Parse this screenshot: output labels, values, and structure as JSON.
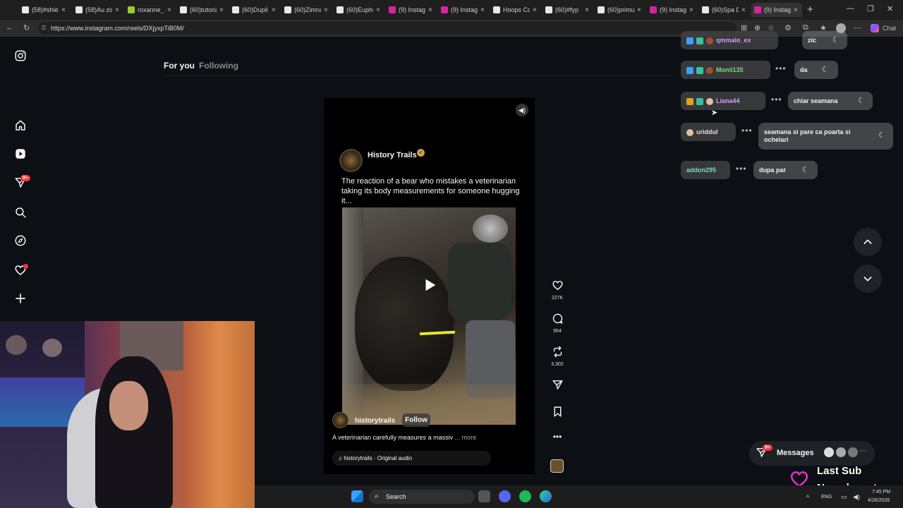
{
  "browser": {
    "tabs": [
      {
        "title": "(58)#shie",
        "icon": "tiktok-icon",
        "color": "#e8e8e8"
      },
      {
        "title": "(58)Au zis",
        "icon": "tiktok-icon",
        "color": "#e8e8e8"
      },
      {
        "title": "roxanne_r",
        "icon": "star-icon",
        "color": "#9acd32"
      },
      {
        "title": "(60)tutoria",
        "icon": "tiktok-icon",
        "color": "#e8e8e8"
      },
      {
        "title": "(60)Dupil",
        "icon": "tiktok-icon",
        "color": "#e8e8e8"
      },
      {
        "title": "(60)Zimna",
        "icon": "tiktok-icon",
        "color": "#e8e8e8"
      },
      {
        "title": "(60)Eupho",
        "icon": "tiktok-icon",
        "color": "#e8e8e8"
      },
      {
        "title": "(9) Instag",
        "icon": "instagram-icon",
        "color": "#d6249f"
      },
      {
        "title": "(9) Instag",
        "icon": "instagram-icon",
        "color": "#d6249f"
      },
      {
        "title": "Hoops Co",
        "icon": "x-icon",
        "color": "#e8e8e8"
      },
      {
        "title": "(60)#fyp",
        "icon": "tiktok-icon",
        "color": "#e8e8e8"
      },
      {
        "title": "(60)primu",
        "icon": "tiktok-icon",
        "color": "#e8e8e8"
      },
      {
        "title": "(9) Instag",
        "icon": "instagram-icon",
        "color": "#d6249f"
      },
      {
        "title": "(60)Spa D",
        "icon": "tiktok-icon",
        "color": "#e8e8e8"
      },
      {
        "title": "(9) Instag",
        "icon": "instagram-icon",
        "color": "#d6249f",
        "active": true
      }
    ],
    "url": "https://www.instagram.com/reels/DXjyxpTiB0M/",
    "chat_label": "Chat"
  },
  "sidebar": {
    "notifications_badge": "9+"
  },
  "header": {
    "for_you": "For you",
    "following": "Following"
  },
  "reel": {
    "channel_name": "History Trails",
    "headline": "The reaction of a bear who mistakes a veterinarian taking its body measurements for someone hugging it...",
    "author": "historytrails",
    "follow": "Follow",
    "caption": "A veterinarian carefully measures a massiv",
    "caption_more": "... more",
    "audio": "historytrails · Original audio",
    "likes": "227K",
    "comments": "954",
    "reposts": "3,302"
  },
  "chat": [
    {
      "user": "qmmalo_ex",
      "user_color": "#c9a0ff",
      "message": "zic"
    },
    {
      "user": "Monii135",
      "user_color": "#7dd87d",
      "message": "da"
    },
    {
      "user": "Liana44",
      "user_color": "#c9a0ff",
      "message": "chiar seamana"
    },
    {
      "user": "uriddul",
      "user_color": "#e0e0e0",
      "message": "seamana si pare ca poarta si ochelari"
    },
    {
      "user": "addon295",
      "user_color": "#7ad6c8",
      "message": "dupa par"
    }
  ],
  "messages": {
    "label": "Messages",
    "badge": "9+"
  },
  "stream_overlay": {
    "last_sub": "Last Sub",
    "no_subs": "No subs yet"
  },
  "taskbar": {
    "search": "Search",
    "lang": "ENG",
    "time": "7:45 PM",
    "date": "4/26/2026"
  },
  "colors": {
    "page_bg": "#0c1014",
    "notification_red": "#ff3040",
    "overlay_heart": "#e62cc8"
  }
}
